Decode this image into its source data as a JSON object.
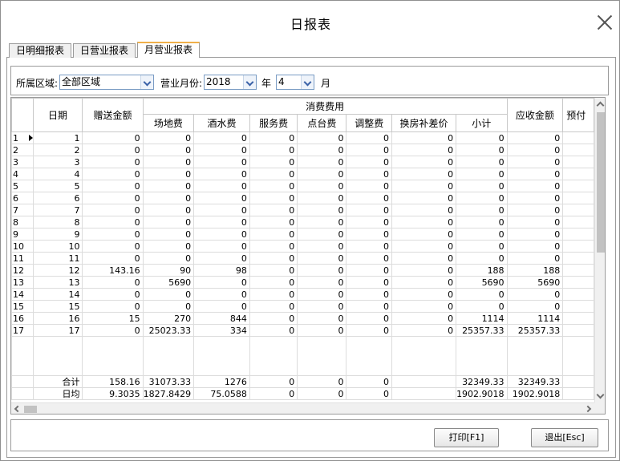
{
  "window": {
    "title": "日报表"
  },
  "tabs": [
    {
      "label": "日明细报表",
      "active": false
    },
    {
      "label": "日营业报表",
      "active": false
    },
    {
      "label": "月营业报表",
      "active": true
    }
  ],
  "filter": {
    "region_label": "所属区域:",
    "region_value": "全部区域",
    "month_label": "营业月份:",
    "year_value": "2018",
    "year_unit": "年",
    "month_value": "4",
    "month_unit": "月"
  },
  "table": {
    "headers": {
      "date": "日期",
      "gift": "赠送金额",
      "consume_group": "消费费用",
      "venue": "场地费",
      "drinks": "酒水费",
      "service": "服务费",
      "table_fee": "点台费",
      "adjust": "调整费",
      "room_diff": "换房补差价",
      "subtotal": "小计",
      "receivable": "应收金额",
      "prepay": "预付"
    },
    "rows": [
      [
        "1",
        "1",
        "0",
        "0",
        "0",
        "0",
        "0",
        "0",
        "0",
        "0",
        "0"
      ],
      [
        "2",
        "2",
        "0",
        "0",
        "0",
        "0",
        "0",
        "0",
        "0",
        "0",
        "0"
      ],
      [
        "3",
        "3",
        "0",
        "0",
        "0",
        "0",
        "0",
        "0",
        "0",
        "0",
        "0"
      ],
      [
        "4",
        "4",
        "0",
        "0",
        "0",
        "0",
        "0",
        "0",
        "0",
        "0",
        "0"
      ],
      [
        "5",
        "5",
        "0",
        "0",
        "0",
        "0",
        "0",
        "0",
        "0",
        "0",
        "0"
      ],
      [
        "6",
        "6",
        "0",
        "0",
        "0",
        "0",
        "0",
        "0",
        "0",
        "0",
        "0"
      ],
      [
        "7",
        "7",
        "0",
        "0",
        "0",
        "0",
        "0",
        "0",
        "0",
        "0",
        "0"
      ],
      [
        "8",
        "8",
        "0",
        "0",
        "0",
        "0",
        "0",
        "0",
        "0",
        "0",
        "0"
      ],
      [
        "9",
        "9",
        "0",
        "0",
        "0",
        "0",
        "0",
        "0",
        "0",
        "0",
        "0"
      ],
      [
        "10",
        "10",
        "0",
        "0",
        "0",
        "0",
        "0",
        "0",
        "0",
        "0",
        "0"
      ],
      [
        "11",
        "11",
        "0",
        "0",
        "0",
        "0",
        "0",
        "0",
        "0",
        "0",
        "0"
      ],
      [
        "12",
        "12",
        "143.16",
        "90",
        "98",
        "0",
        "0",
        "0",
        "0",
        "188",
        "188"
      ],
      [
        "13",
        "13",
        "0",
        "5690",
        "0",
        "0",
        "0",
        "0",
        "0",
        "5690",
        "5690"
      ],
      [
        "14",
        "14",
        "0",
        "0",
        "0",
        "0",
        "0",
        "0",
        "0",
        "0",
        "0"
      ],
      [
        "15",
        "15",
        "0",
        "0",
        "0",
        "0",
        "0",
        "0",
        "0",
        "0",
        "0"
      ],
      [
        "16",
        "16",
        "15",
        "270",
        "844",
        "0",
        "0",
        "0",
        "0",
        "1114",
        "1114"
      ],
      [
        "17",
        "17",
        "0",
        "25023.33",
        "334",
        "0",
        "0",
        "0",
        "0",
        "25357.33",
        "25357.33"
      ]
    ],
    "summary": [
      [
        "合计",
        "158.16",
        "31073.33",
        "1276",
        "0",
        "0",
        "0",
        "",
        "32349.33",
        "32349.33"
      ],
      [
        "日均",
        "9.3035",
        "1827.8429",
        "75.0588",
        "0",
        "0",
        "0",
        "",
        "1902.9018",
        "1902.9018"
      ]
    ]
  },
  "buttons": {
    "print": "打印[F1]",
    "exit": "退出[Esc]"
  }
}
